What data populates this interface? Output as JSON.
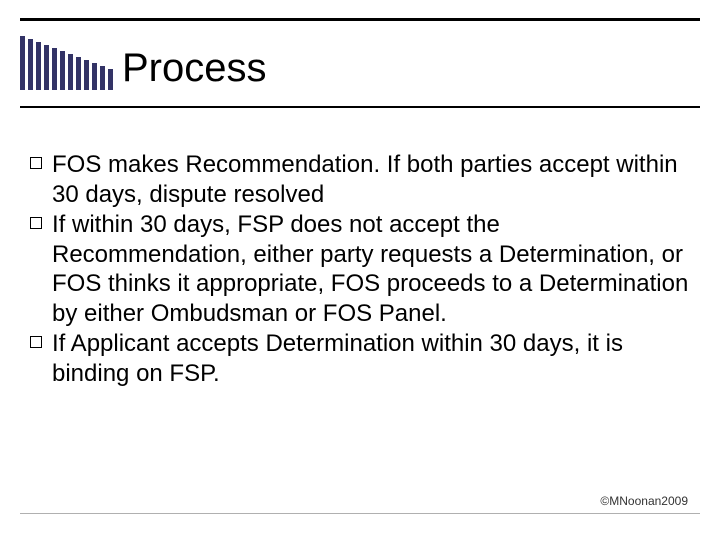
{
  "title": "Process",
  "bullets": [
    "FOS makes Recommendation. If both parties accept within 30 days, dispute resolved",
    "If within 30 days, FSP does not accept the Recommendation, either party requests a Determination, or FOS thinks it appropriate, FOS proceeds to a Determination by either Ombudsman or FOS Panel.",
    "If Applicant accepts Determination within 30 days, it is binding on FSP."
  ],
  "copyright": "©MNoonan2009",
  "bars_heights": [
    54,
    51,
    48,
    45,
    42,
    39,
    36,
    33,
    30,
    27,
    24,
    21
  ]
}
